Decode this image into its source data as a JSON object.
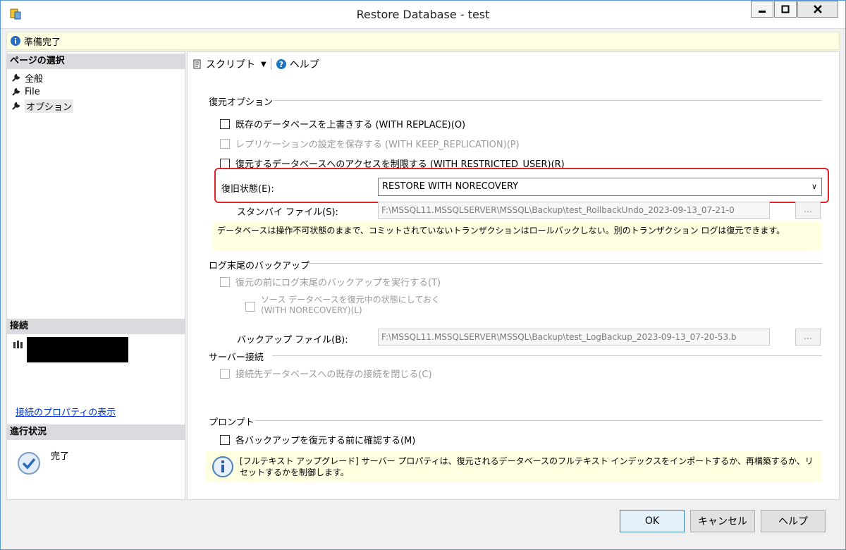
{
  "window": {
    "title": "Restore Database - test",
    "status": "準備完了"
  },
  "left": {
    "page_select_header": "ページの選択",
    "pages": [
      {
        "label": "全般",
        "selected": false
      },
      {
        "label": "File",
        "selected": false
      },
      {
        "label": "オプション",
        "selected": true
      }
    ],
    "connection_header": "接続",
    "connection_link": "接続のプロパティの表示",
    "progress_header": "進行状況",
    "progress_status": "完了"
  },
  "toolbar": {
    "script_label": "スクリプト",
    "help_label": "ヘルプ"
  },
  "restore_options": {
    "title": "復元オプション",
    "replace": "既存のデータベースを上書きする (WITH REPLACE)(O)",
    "keep_replication": "レプリケーションの設定を保存する (WITH KEEP_REPLICATION)(P)",
    "restricted_user": "復元するデータベースへのアクセスを制限する (WITH RESTRICTED_USER)(R)",
    "recovery_state_label": "復旧状態(E):",
    "recovery_state_value": "RESTORE WITH NORECOVERY",
    "standby_file_label": "スタンバイ ファイル(S):",
    "standby_file_value": "F:\\MSSQL11.MSSQLSERVER\\MSSQL\\Backup\\test_RollbackUndo_2023-09-13_07-21-0",
    "browse": "...",
    "description": "データベースは操作不可状態のままで、コミットされていないトランザクションはロールバックしない。別のトランザクション ログは復元できます。"
  },
  "tail_log": {
    "title": "ログ末尾のバックアップ",
    "backup_before": "復元の前にログ末尾のバックアップを実行する(T)",
    "leave_source_line1": "ソース データベースを復元中の状態にしておく",
    "leave_source_line2": "(WITH NORECOVERY)(L)",
    "backup_file_label": "バックアップ ファイル(B):",
    "backup_file_value": "F:\\MSSQL11.MSSQLSERVER\\MSSQL\\Backup\\test_LogBackup_2023-09-13_07-20-53.b",
    "browse": "..."
  },
  "server_connections": {
    "title": "サーバー接続",
    "close_existing": "接続先データベースへの既存の接続を閉じる(C)"
  },
  "prompt": {
    "title": "プロンプト",
    "confirm_each": "各バックアップを復元する前に確認する(M)",
    "info": "[フルテキスト アップグレード] サーバー プロパティは、復元されるデータベースのフルテキスト インデックスをインポートするか、再構築するか、リセットするかを制御します。"
  },
  "buttons": {
    "ok": "OK",
    "cancel": "キャンセル",
    "help": "ヘルプ"
  }
}
